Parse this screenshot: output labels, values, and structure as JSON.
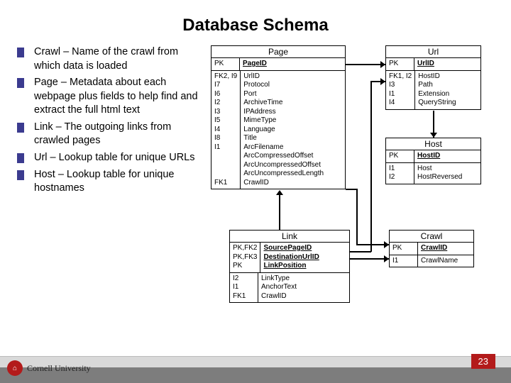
{
  "title": "Database Schema",
  "bullets": [
    "Crawl – Name of the crawl from which data is loaded",
    "Page – Metadata about each webpage plus fields to help find and extract the full html text",
    "Link – The outgoing links from crawled pages",
    "Url – Lookup table for unique URLs",
    "Host – Lookup table for unique hostnames"
  ],
  "entities": {
    "page": {
      "name": "Page",
      "pk": [
        {
          "k": "PK",
          "f": "PageID"
        }
      ],
      "rows": [
        {
          "k": "FK2, I9",
          "f": "UrlID"
        },
        {
          "k": "I7",
          "f": "Protocol"
        },
        {
          "k": "I6",
          "f": "Port"
        },
        {
          "k": "I2",
          "f": "ArchiveTime"
        },
        {
          "k": "I3",
          "f": "IPAddress"
        },
        {
          "k": "I5",
          "f": "MimeType"
        },
        {
          "k": "I4",
          "f": "Language"
        },
        {
          "k": "I8",
          "f": "Title"
        },
        {
          "k": "I1",
          "f": "ArcFilename"
        },
        {
          "k": "",
          "f": "ArcCompressedOffset"
        },
        {
          "k": "",
          "f": "ArcUncompressedOffset"
        },
        {
          "k": "",
          "f": "ArcUncompressedLength"
        },
        {
          "k": "FK1",
          "f": "CrawlID"
        }
      ]
    },
    "url": {
      "name": "Url",
      "pk": [
        {
          "k": "PK",
          "f": "UrlID"
        }
      ],
      "rows": [
        {
          "k": "FK1, I2",
          "f": "HostID"
        },
        {
          "k": "I3",
          "f": "Path"
        },
        {
          "k": "I1",
          "f": "Extension"
        },
        {
          "k": "I4",
          "f": "QueryString"
        }
      ]
    },
    "host": {
      "name": "Host",
      "pk": [
        {
          "k": "PK",
          "f": "HostID"
        }
      ],
      "rows": [
        {
          "k": "I1",
          "f": "Host"
        },
        {
          "k": "I2",
          "f": "HostReversed"
        }
      ]
    },
    "link": {
      "name": "Link",
      "pk": [
        {
          "k": "PK,FK2",
          "f": "SourcePageID"
        },
        {
          "k": "PK,FK3",
          "f": "DestinationUrlID"
        },
        {
          "k": "PK",
          "f": "LinkPosition"
        }
      ],
      "rows": [
        {
          "k": "I2",
          "f": "LinkType"
        },
        {
          "k": "I1",
          "f": "AnchorText"
        },
        {
          "k": "FK1",
          "f": "CrawlID"
        }
      ]
    },
    "crawl": {
      "name": "Crawl",
      "pk": [
        {
          "k": "PK",
          "f": "CrawlID"
        }
      ],
      "rows": [
        {
          "k": "I1",
          "f": "CrawlName"
        }
      ]
    }
  },
  "footer": {
    "org": "Cornell University",
    "page_number": "23"
  }
}
